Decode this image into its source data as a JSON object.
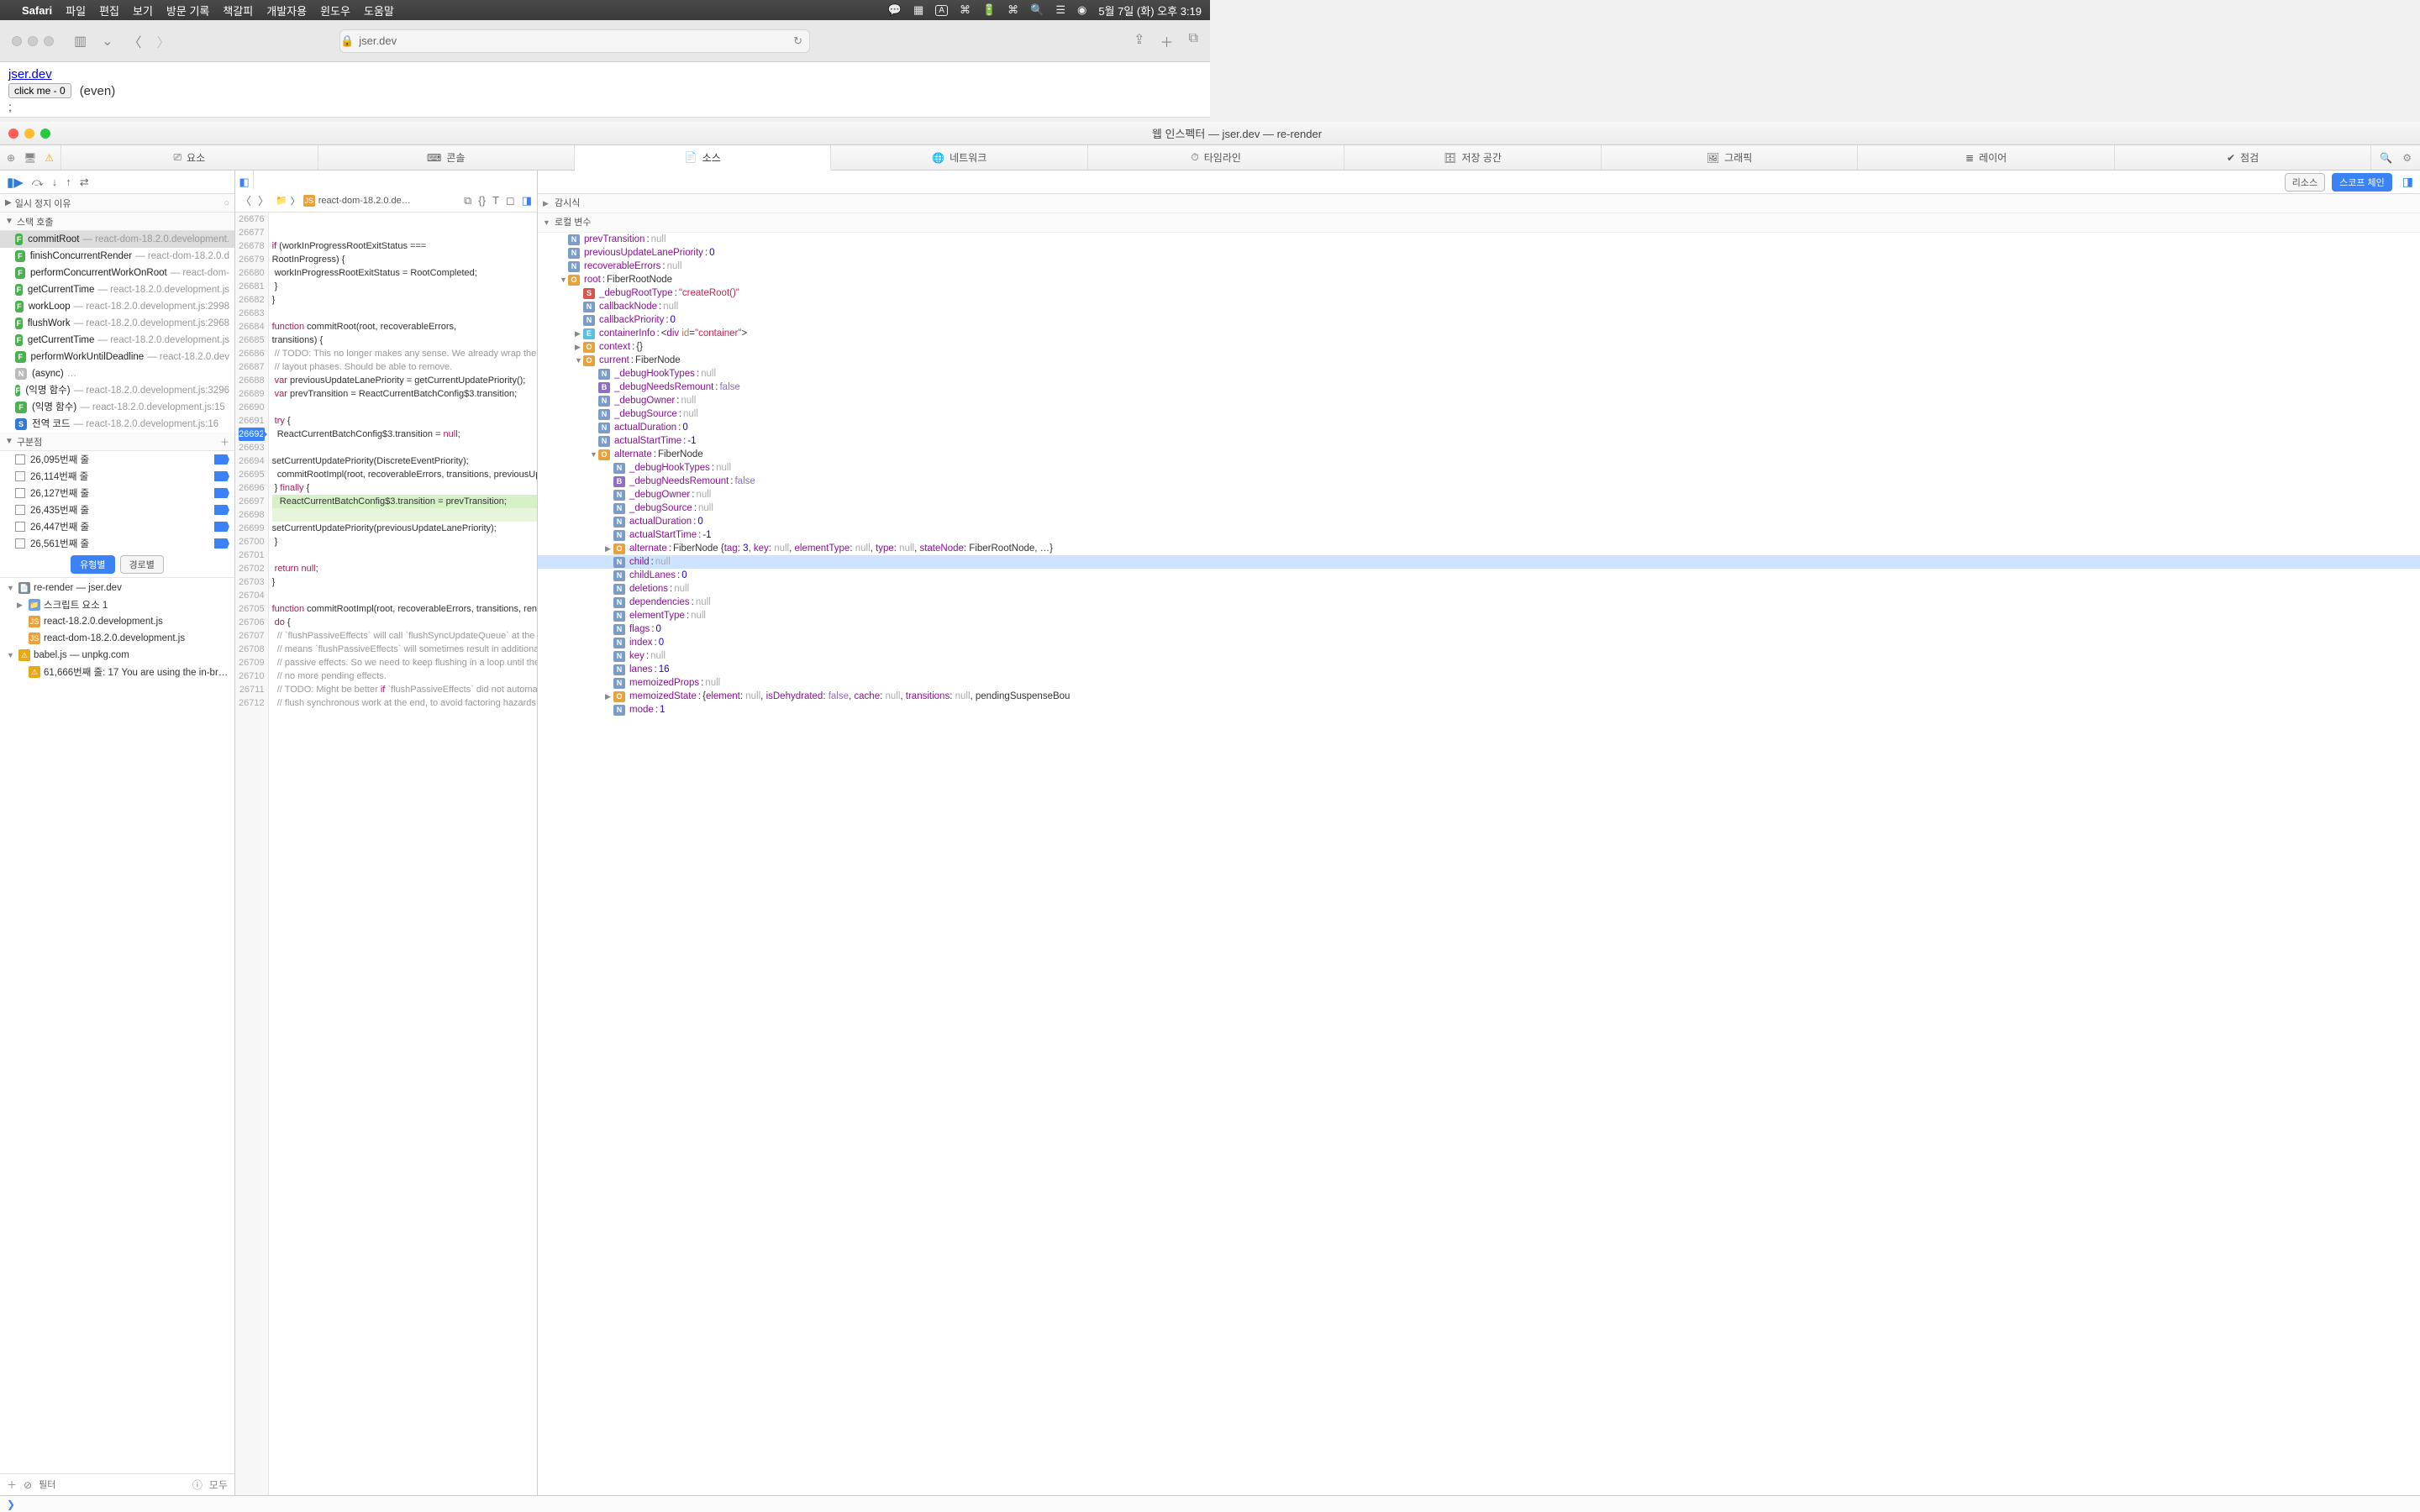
{
  "menubar": {
    "app": "Safari",
    "items": [
      "파일",
      "편집",
      "보기",
      "방문 기록",
      "책갈피",
      "개발자용",
      "윈도우",
      "도움말"
    ],
    "clock": "5월 7일 (화) 오후 3:19"
  },
  "browser": {
    "url_host": "jser.dev",
    "page_link": "jser.dev",
    "button_label": "click me - 0",
    "even_text": "(even)",
    "semi": ";"
  },
  "inspector": {
    "title": "웹 인스펙터 — jser.dev — re-render",
    "tabs": {
      "elements": "요소",
      "console": "콘솔",
      "sources": "소스",
      "network": "네트워크",
      "timelines": "타임라인",
      "storage": "저장 공간",
      "graphics": "그래픽",
      "layers": "레이어",
      "audit": "점검"
    },
    "left": {
      "pause_reason": "일시 정지 이유",
      "call_stack": "스택 호출",
      "stack": [
        {
          "t": "F",
          "n": "commitRoot",
          "l": "— react-dom-18.2.0.development.",
          "sel": true
        },
        {
          "t": "F",
          "n": "finishConcurrentRender",
          "l": "— react-dom-18.2.0.d"
        },
        {
          "t": "F",
          "n": "performConcurrentWorkOnRoot",
          "l": "— react-dom-"
        },
        {
          "t": "F",
          "n": "getCurrentTime",
          "l": "— react-18.2.0.development.js"
        },
        {
          "t": "F",
          "n": "workLoop",
          "l": "— react-18.2.0.development.js:2998"
        },
        {
          "t": "F",
          "n": "flushWork",
          "l": "— react-18.2.0.development.js:2968"
        },
        {
          "t": "F",
          "n": "getCurrentTime",
          "l": "— react-18.2.0.development.js"
        },
        {
          "t": "F",
          "n": "performWorkUntilDeadline",
          "l": "— react-18.2.0.dev"
        },
        {
          "t": "N",
          "n": "(async)",
          "l": "…",
          "gray": true
        },
        {
          "t": "F",
          "n": "(익명 함수)",
          "l": "— react-18.2.0.development.js:3296"
        },
        {
          "t": "F",
          "n": "(익명 함수)",
          "l": "— react-18.2.0.development.js:15"
        },
        {
          "t": "S",
          "n": "전역 코드",
          "l": "— react-18.2.0.development.js:16",
          "blue": true
        }
      ],
      "breakpoints_h": "구분점",
      "breakpoints": [
        "26,095번째 줄",
        "26,114번째 줄",
        "26,127번째 줄",
        "26,435번째 줄",
        "26,447번째 줄",
        "26,561번째 줄"
      ],
      "toggle_type": "유형별",
      "toggle_path": "경로별",
      "tree": [
        {
          "d": 1,
          "ic": "📄",
          "t": "re-render — jser.dev",
          "open": true
        },
        {
          "d": 2,
          "ic": "📁",
          "t": "스크립트 요소 1",
          "disc": "▶"
        },
        {
          "d": 2,
          "ic": "JS",
          "t": "react-18.2.0.development.js"
        },
        {
          "d": 2,
          "ic": "JS",
          "t": "react-dom-18.2.0.development.js"
        },
        {
          "d": 1,
          "ic": "⚠",
          "t": "babel.js — unpkg.com",
          "open": true
        },
        {
          "d": 2,
          "ic": "⚠",
          "t": "61,666번째 줄: 17 You are using the in-br…"
        }
      ],
      "filter_ph": "필터",
      "all": "모두"
    },
    "mid": {
      "crumb_folder_ic": "📁",
      "crumb_file": "react-dom-18.2.0.de…",
      "lines_start": 26676,
      "exec_line": 26692,
      "code": [
        "",
        "",
        "if (workInProgressRootExitStatus ===",
        "RootInProgress) {",
        " workInProgressRootExitStatus = RootCompleted;",
        " }",
        "}",
        "",
        "function commitRoot(root, recoverableErrors,",
        "transitions) {",
        " // TODO: This no longer makes any sense. We already wrap the mutation and",
        " // layout phases. Should be able to remove.",
        " var previousUpdateLanePriority = getCurrentUpdatePriority();",
        " var prevTransition = ReactCurrentBatchConfig$3.transition;",
        "",
        " try {",
        "  ReactCurrentBatchConfig$3.transition = null;",
        "",
        "setCurrentUpdatePriority(DiscreteEventPriority);",
        "  commitRootImpl(root, recoverableErrors, transitions, previousUpdateLanePriority);",
        " } finally {",
        "   ReactCurrentBatchConfig$3.transition = prevTransition;",
        "",
        "setCurrentUpdatePriority(previousUpdateLanePriority);",
        " }",
        "",
        " return null;",
        "}",
        "",
        "function commitRootImpl(root, recoverableErrors, transitions, renderPriorityLevel) {",
        " do {",
        "  // `flushPassiveEffects` will call `flushSyncUpdateQueue` at the end, which",
        "  // means `flushPassiveEffects` will sometimes result in additional",
        "  // passive effects. So we need to keep flushing in a loop until there are",
        "  // no more pending effects.",
        "  // TODO: Might be better if `flushPassiveEffects` did not automatically",
        "  // flush synchronous work at the end, to avoid factoring hazards like this."
      ],
      "hl_lines": [
        21
      ],
      "hl2_lines": [
        22
      ]
    },
    "right": {
      "pill_res": "리소스",
      "pill_scope": "스코프 체인",
      "watch_h": "감시식",
      "local_h": "로컬 변수",
      "rows": [
        {
          "d": 1,
          "b": "N",
          "p": "prevTransition",
          "v": "null",
          "vt": "null"
        },
        {
          "d": 1,
          "b": "N",
          "p": "previousUpdateLanePriority",
          "v": "0",
          "vt": "num"
        },
        {
          "d": 1,
          "b": "N",
          "p": "recoverableErrors",
          "v": "null",
          "vt": "null"
        },
        {
          "d": 1,
          "b": "O",
          "p": "root",
          "v": "FiberRootNode",
          "vt": "obj",
          "disc": "▼"
        },
        {
          "d": 2,
          "b": "S",
          "p": "_debugRootType",
          "v": "\"createRoot()\"",
          "vt": "str"
        },
        {
          "d": 2,
          "b": "N",
          "p": "callbackNode",
          "v": "null",
          "vt": "null"
        },
        {
          "d": 2,
          "b": "N",
          "p": "callbackPriority",
          "v": "0",
          "vt": "num"
        },
        {
          "d": 2,
          "b": "E",
          "p": "containerInfo",
          "html": {
            "tag": "div",
            "attr": "id",
            "val": "\"container\""
          },
          "disc": "▶"
        },
        {
          "d": 2,
          "b": "O",
          "p": "context",
          "v": "{}",
          "vt": "obj",
          "disc": "▶"
        },
        {
          "d": 2,
          "b": "O",
          "p": "current",
          "v": "FiberNode",
          "vt": "obj",
          "disc": "▼"
        },
        {
          "d": 3,
          "b": "N",
          "p": "_debugHookTypes",
          "v": "null",
          "vt": "null"
        },
        {
          "d": 3,
          "b": "B",
          "p": "_debugNeedsRemount",
          "v": "false",
          "vt": "bool"
        },
        {
          "d": 3,
          "b": "N",
          "p": "_debugOwner",
          "v": "null",
          "vt": "null"
        },
        {
          "d": 3,
          "b": "N",
          "p": "_debugSource",
          "v": "null",
          "vt": "null"
        },
        {
          "d": 3,
          "b": "N",
          "p": "actualDuration",
          "v": "0",
          "vt": "num"
        },
        {
          "d": 3,
          "b": "N",
          "p": "actualStartTime",
          "v": "-1",
          "vt": "num"
        },
        {
          "d": 3,
          "b": "O",
          "p": "alternate",
          "v": "FiberNode",
          "vt": "obj",
          "disc": "▼"
        },
        {
          "d": 4,
          "b": "N",
          "p": "_debugHookTypes",
          "v": "null",
          "vt": "null"
        },
        {
          "d": 4,
          "b": "B",
          "p": "_debugNeedsRemount",
          "v": "false",
          "vt": "bool"
        },
        {
          "d": 4,
          "b": "N",
          "p": "_debugOwner",
          "v": "null",
          "vt": "null"
        },
        {
          "d": 4,
          "b": "N",
          "p": "_debugSource",
          "v": "null",
          "vt": "null"
        },
        {
          "d": 4,
          "b": "N",
          "p": "actualDuration",
          "v": "0",
          "vt": "num"
        },
        {
          "d": 4,
          "b": "N",
          "p": "actualStartTime",
          "v": "-1",
          "vt": "num"
        },
        {
          "d": 4,
          "b": "O",
          "p": "alternate",
          "v": "FiberNode {tag: 3, key: null, elementType: null, type: null, stateNode: FiberRootNode, …}",
          "vt": "obj",
          "disc": "▶",
          "rich": true
        },
        {
          "d": 4,
          "b": "N",
          "p": "child",
          "v": "null",
          "vt": "null",
          "sel": true
        },
        {
          "d": 4,
          "b": "N",
          "p": "childLanes",
          "v": "0",
          "vt": "num"
        },
        {
          "d": 4,
          "b": "N",
          "p": "deletions",
          "v": "null",
          "vt": "null"
        },
        {
          "d": 4,
          "b": "N",
          "p": "dependencies",
          "v": "null",
          "vt": "null"
        },
        {
          "d": 4,
          "b": "N",
          "p": "elementType",
          "v": "null",
          "vt": "null"
        },
        {
          "d": 4,
          "b": "N",
          "p": "flags",
          "v": "0",
          "vt": "num"
        },
        {
          "d": 4,
          "b": "N",
          "p": "index",
          "v": "0",
          "vt": "num"
        },
        {
          "d": 4,
          "b": "N",
          "p": "key",
          "v": "null",
          "vt": "null"
        },
        {
          "d": 4,
          "b": "N",
          "p": "lanes",
          "v": "16",
          "vt": "num"
        },
        {
          "d": 4,
          "b": "N",
          "p": "memoizedProps",
          "v": "null",
          "vt": "null"
        },
        {
          "d": 4,
          "b": "O",
          "p": "memoizedState",
          "v": "{element: null, isDehydrated: false, cache: null, transitions: null, pendingSuspenseBou",
          "vt": "obj",
          "disc": "▶",
          "rich": true
        },
        {
          "d": 4,
          "b": "N",
          "p": "mode",
          "v": "1",
          "vt": "num"
        }
      ]
    },
    "console_prompt": "❯"
  }
}
